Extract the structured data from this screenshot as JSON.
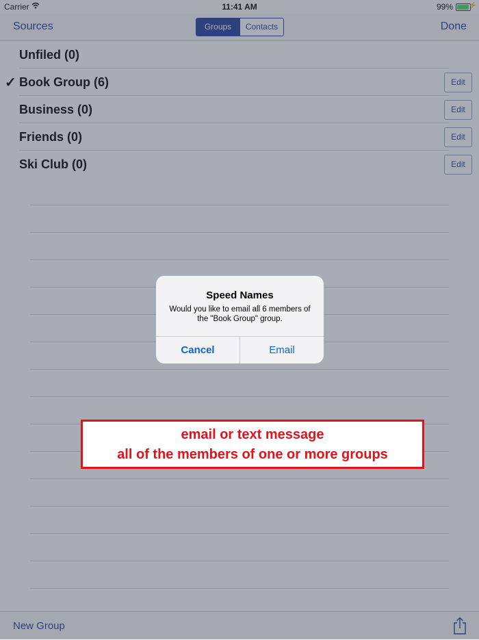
{
  "status_bar": {
    "carrier": "Carrier",
    "time": "11:41 AM",
    "battery_percent": "99%",
    "battery_level": 0.99
  },
  "nav": {
    "left_label": "Sources",
    "segments": [
      "Groups",
      "Contacts"
    ],
    "selected_segment": "Groups",
    "right_label": "Done"
  },
  "groups": [
    {
      "label": "Unfiled (0)",
      "checked": false,
      "edit": ""
    },
    {
      "label": "Book Group (6)",
      "checked": true,
      "edit": "Edit"
    },
    {
      "label": "Business (0)",
      "checked": false,
      "edit": "Edit"
    },
    {
      "label": "Friends (0)",
      "checked": false,
      "edit": "Edit"
    },
    {
      "label": "Ski Club (0)",
      "checked": false,
      "edit": "Edit"
    }
  ],
  "checkmark": "✓",
  "toolbar": {
    "new_group_label": "New Group",
    "share_icon": "share-icon"
  },
  "alert": {
    "title": "Speed Names",
    "message": "Would you like to email all 6 members of the \"Book Group\" group.",
    "cancel_label": "Cancel",
    "email_label": "Email"
  },
  "callout": {
    "line1": "email or text message",
    "line2": "all of the members of one or more groups"
  },
  "colors": {
    "accent": "#1f3d99",
    "alert_button": "#0b63d6",
    "callout_red": "#e0141a",
    "battery_green": "#4cd964"
  }
}
